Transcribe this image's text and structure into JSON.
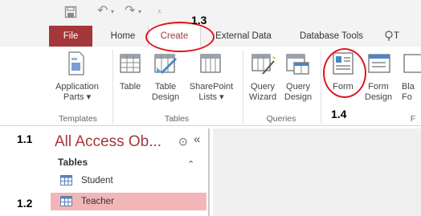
{
  "ribbon_tabs": [
    {
      "label": "File"
    },
    {
      "label": "Home"
    },
    {
      "label": "Create"
    },
    {
      "label": "External Data"
    },
    {
      "label": "Database Tools"
    },
    {
      "label": "T"
    }
  ],
  "groups": {
    "templates": {
      "label": "Templates",
      "buttons": [
        {
          "label1": "Application",
          "label2": "Parts ▾"
        }
      ]
    },
    "tables": {
      "label": "Tables",
      "buttons": [
        {
          "label1": "Table",
          "label2": ""
        },
        {
          "label1": "Table",
          "label2": "Design"
        },
        {
          "label1": "SharePoint",
          "label2": "Lists ▾"
        }
      ]
    },
    "queries": {
      "label": "Queries",
      "buttons": [
        {
          "label1": "Query",
          "label2": "Wizard"
        },
        {
          "label1": "Query",
          "label2": "Design"
        }
      ]
    },
    "forms": {
      "label": "F",
      "buttons": [
        {
          "label1": "Form",
          "label2": ""
        },
        {
          "label1": "Form",
          "label2": "Design"
        },
        {
          "label1": "Bla",
          "label2": "Fo"
        }
      ]
    }
  },
  "nav": {
    "title": "All Access Ob...",
    "dropdown": "⊙",
    "collapse": "«",
    "section": "Tables",
    "section_toggle": "⌃",
    "items": [
      {
        "label": "Student"
      },
      {
        "label": "Teacher"
      }
    ]
  },
  "annotations": {
    "a11": "1.1",
    "a12": "1.2",
    "a13": "1.3",
    "a14": "1.4"
  },
  "colors": {
    "accent": "#a4373a",
    "selected_row": "#f3b6b8",
    "annotation_red": "#e0161d"
  },
  "icons": {
    "save": "save-icon",
    "undo": "undo-icon",
    "redo": "redo-icon",
    "qat_more": "customize-qat-icon",
    "tell_me": "lightbulb-icon"
  }
}
